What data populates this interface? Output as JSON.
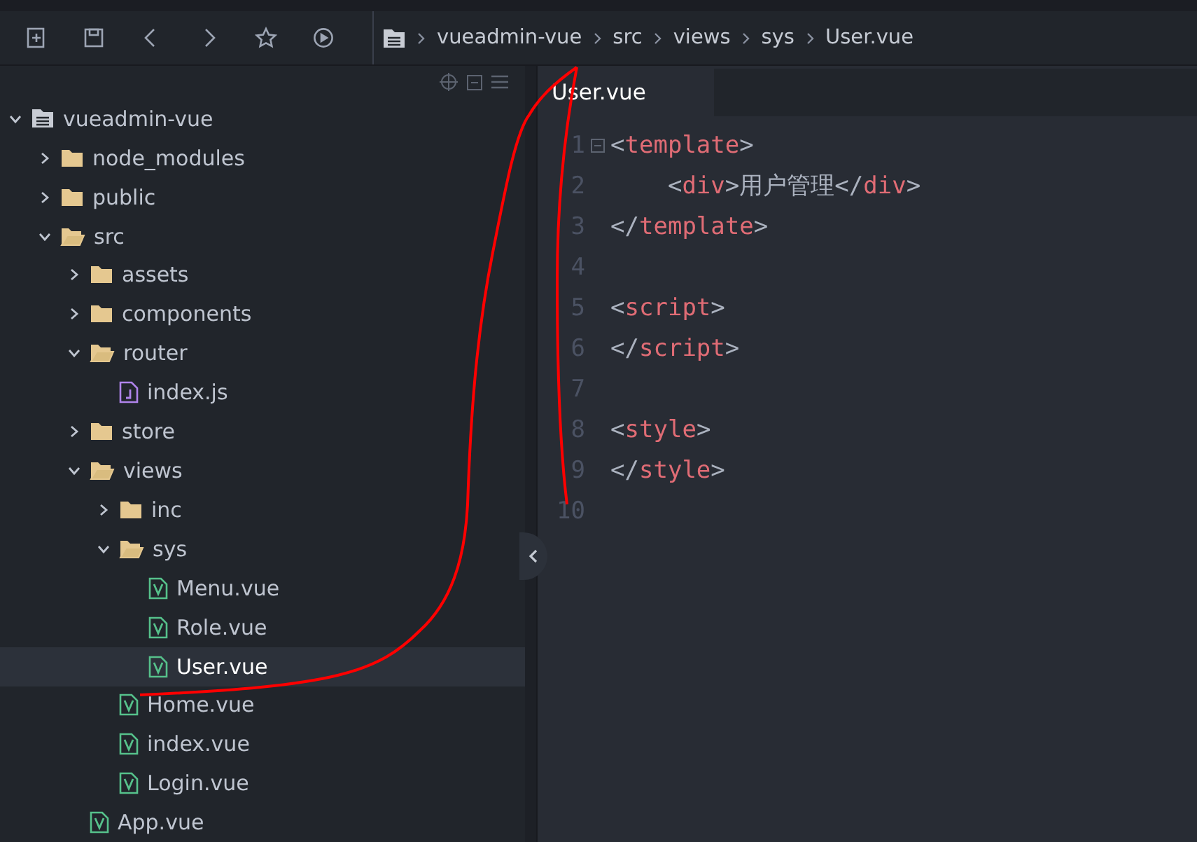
{
  "toolbar": {
    "buttons": [
      {
        "kind": "new"
      },
      {
        "kind": "save"
      },
      {
        "kind": "back"
      },
      {
        "kind": "forward"
      },
      {
        "kind": "star"
      },
      {
        "kind": "run"
      }
    ]
  },
  "breadcrumb": [
    "vueadmin-vue",
    "src",
    "views",
    "sys",
    "User.vue"
  ],
  "sidebar": {
    "tree": [
      {
        "name": "vueadmin-vue",
        "kind": "project",
        "expanded": true,
        "selected": false,
        "children": [
          {
            "name": "node_modules",
            "kind": "folder",
            "expanded": false,
            "selected": false
          },
          {
            "name": "public",
            "kind": "folder",
            "expanded": false,
            "selected": false
          },
          {
            "name": "src",
            "kind": "folder",
            "expanded": true,
            "selected": false,
            "children": [
              {
                "name": "assets",
                "kind": "folder",
                "expanded": false,
                "selected": false
              },
              {
                "name": "components",
                "kind": "folder",
                "expanded": false,
                "selected": false
              },
              {
                "name": "router",
                "kind": "folder",
                "expanded": true,
                "selected": false,
                "children": [
                  {
                    "name": "index.js",
                    "kind": "js",
                    "selected": false
                  }
                ]
              },
              {
                "name": "store",
                "kind": "folder",
                "expanded": false,
                "selected": false
              },
              {
                "name": "views",
                "kind": "folder",
                "expanded": true,
                "selected": false,
                "children": [
                  {
                    "name": "inc",
                    "kind": "folder",
                    "expanded": false,
                    "selected": false
                  },
                  {
                    "name": "sys",
                    "kind": "folder",
                    "expanded": true,
                    "selected": false,
                    "children": [
                      {
                        "name": "Menu.vue",
                        "kind": "vue",
                        "selected": false
                      },
                      {
                        "name": "Role.vue",
                        "kind": "vue",
                        "selected": false
                      },
                      {
                        "name": "User.vue",
                        "kind": "vue",
                        "selected": true
                      }
                    ]
                  },
                  {
                    "name": "Home.vue",
                    "kind": "vue",
                    "selected": false
                  },
                  {
                    "name": "index.vue",
                    "kind": "vue",
                    "selected": false
                  },
                  {
                    "name": "Login.vue",
                    "kind": "vue",
                    "selected": false
                  }
                ]
              },
              {
                "name": "App.vue",
                "kind": "vue",
                "selected": false
              }
            ]
          }
        ]
      }
    ]
  },
  "editor": {
    "tabs": [
      {
        "label": "User.vue",
        "selected": true
      }
    ],
    "lines": [
      {
        "number": "1",
        "fold": true,
        "tokens": [
          {
            "text": "<",
            "kind": "punct"
          },
          {
            "text": "template",
            "kind": "tag"
          },
          {
            "text": ">",
            "kind": "punct"
          }
        ]
      },
      {
        "number": "2",
        "fold": false,
        "tokens": [
          {
            "text": "    <",
            "kind": "punct"
          },
          {
            "text": "div",
            "kind": "tag"
          },
          {
            "text": ">用户管理</",
            "kind": "punct"
          },
          {
            "text": "div",
            "kind": "tag"
          },
          {
            "text": ">",
            "kind": "punct"
          }
        ]
      },
      {
        "number": "3",
        "fold": false,
        "tokens": [
          {
            "text": "</",
            "kind": "punct"
          },
          {
            "text": "template",
            "kind": "tag"
          },
          {
            "text": ">",
            "kind": "punct"
          }
        ]
      },
      {
        "number": "4",
        "fold": false
      },
      {
        "number": "5",
        "fold": false,
        "tokens": [
          {
            "text": "<",
            "kind": "punct"
          },
          {
            "text": "script",
            "kind": "tag"
          },
          {
            "text": ">",
            "kind": "punct"
          }
        ]
      },
      {
        "number": "6",
        "fold": false,
        "tokens": [
          {
            "text": "</",
            "kind": "punct"
          },
          {
            "text": "script",
            "kind": "tag"
          },
          {
            "text": ">",
            "kind": "punct"
          }
        ]
      },
      {
        "number": "7",
        "fold": false
      },
      {
        "number": "8",
        "fold": false,
        "tokens": [
          {
            "text": "<",
            "kind": "punct"
          },
          {
            "text": "style",
            "kind": "tag"
          },
          {
            "text": ">",
            "kind": "punct"
          }
        ]
      },
      {
        "number": "9",
        "fold": false,
        "tokens": [
          {
            "text": "</",
            "kind": "punct"
          },
          {
            "text": "style",
            "kind": "tag"
          },
          {
            "text": ">",
            "kind": "punct"
          }
        ]
      },
      {
        "number": "10",
        "fold": false
      }
    ]
  }
}
